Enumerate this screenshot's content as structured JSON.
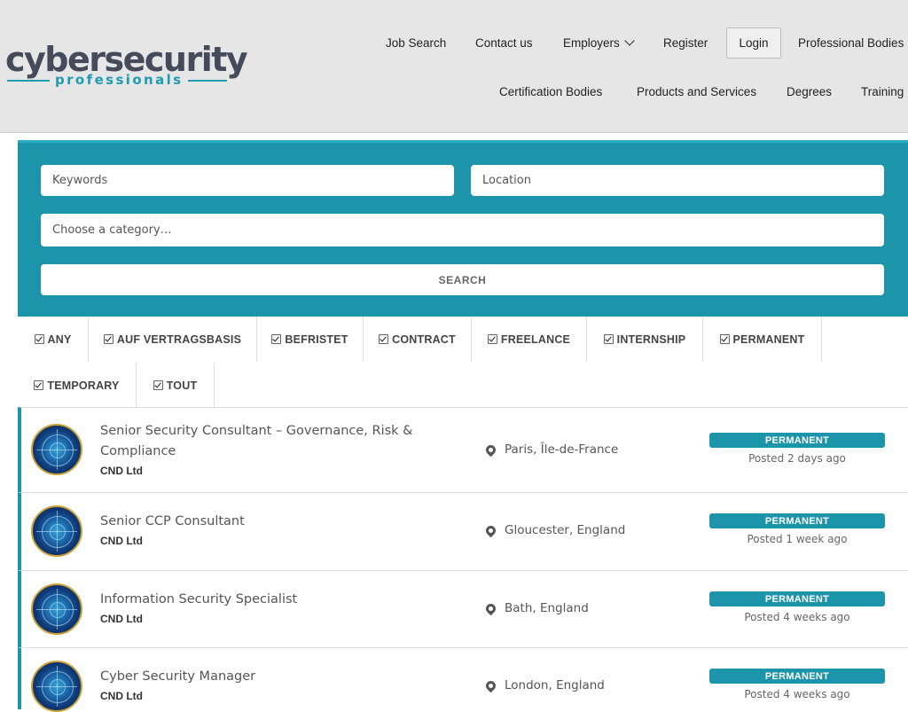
{
  "logo": {
    "main": "cybersecurity",
    "sub": "professionals"
  },
  "nav": {
    "row1": [
      "Job Search",
      "Contact us",
      "Employers",
      "Register",
      "Login",
      "Professional Bodies"
    ],
    "row2": [
      "Certification Bodies",
      "Products and Services",
      "Degrees",
      "Training"
    ]
  },
  "search": {
    "keywords_placeholder": "Keywords",
    "location_placeholder": "Location",
    "category_placeholder": "Choose a category…",
    "button_label": "SEARCH"
  },
  "filters": [
    "ANY",
    "AUF VERTRAGSBASIS",
    "BEFRISTET",
    "CONTRACT",
    "FREELANCE",
    "INTERNSHIP",
    "PERMANENT",
    "TEMPORARY",
    "TOUT"
  ],
  "jobs": [
    {
      "title": "Senior Security Consultant – Governance, Risk & Compliance",
      "company": "CND Ltd",
      "location": "Paris, Île-de-France",
      "type": "PERMANENT",
      "posted": "Posted 2 days ago"
    },
    {
      "title": "Senior CCP Consultant",
      "company": "CND Ltd",
      "location": "Gloucester, England",
      "type": "PERMANENT",
      "posted": "Posted 1 week ago"
    },
    {
      "title": "Information Security Specialist",
      "company": "CND Ltd",
      "location": "Bath, England",
      "type": "PERMANENT",
      "posted": "Posted 4 weeks ago"
    },
    {
      "title": "Cyber Security Manager",
      "company": "CND Ltd",
      "location": "London, England",
      "type": "PERMANENT",
      "posted": "Posted 4 weeks ago"
    }
  ],
  "colors": {
    "accent": "#1c95ab",
    "header_bg": "#e6e6e6",
    "logo_text": "#454b5a"
  }
}
